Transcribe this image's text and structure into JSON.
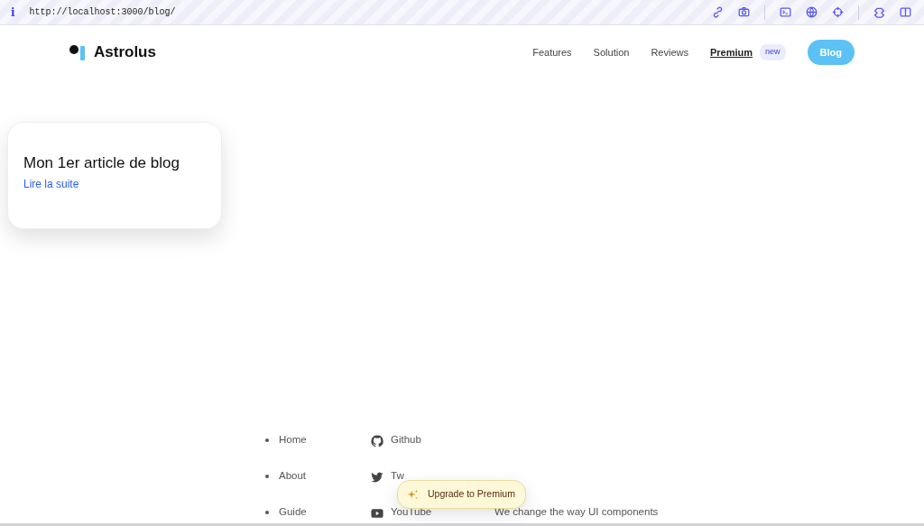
{
  "browser": {
    "info_icon": "i",
    "url": "http://localhost:3000/blog/"
  },
  "brand": {
    "name": "Astrolus"
  },
  "nav": [
    {
      "label": "Features",
      "kind": "link"
    },
    {
      "label": "Solution",
      "kind": "link"
    },
    {
      "label": "Reviews",
      "kind": "link"
    },
    {
      "label": "Premium",
      "kind": "premium",
      "badge": "new"
    },
    {
      "label": "Blog",
      "kind": "button"
    }
  ],
  "posts": [
    {
      "title": "Mon 1er article de blog",
      "link": "Lire la suite"
    }
  ],
  "footer": {
    "pages": [
      "Home",
      "About",
      "Guide"
    ],
    "social": [
      {
        "label": "Github",
        "kind": "github"
      },
      {
        "label": "Tw",
        "kind": "twitter"
      },
      {
        "label": "YouTube",
        "kind": "youtube"
      }
    ],
    "tagline": "We change the way UI components"
  },
  "popup": {
    "label": "Upgrade to Premium"
  }
}
